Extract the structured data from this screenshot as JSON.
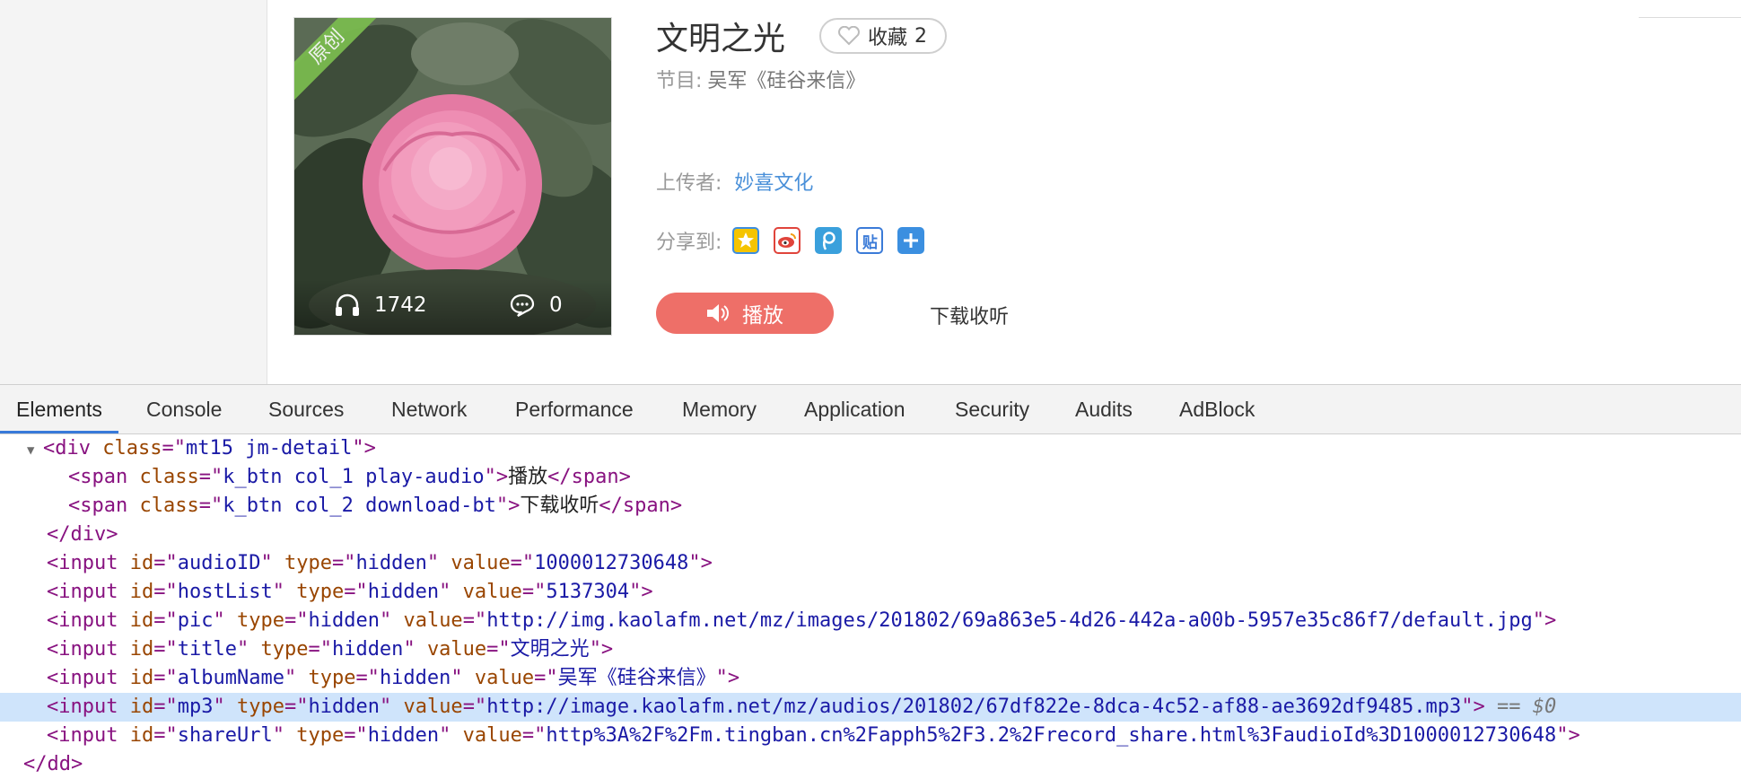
{
  "page": {
    "cover": {
      "badge": "原创",
      "listen_count": "1742",
      "comment_count": "0"
    },
    "title": "文明之光",
    "favorite": {
      "label": "收藏",
      "count": "2"
    },
    "program": {
      "label": "节目:",
      "value": "吴军《硅谷来信》"
    },
    "uploader": {
      "label": "上传者:",
      "value": "妙喜文化"
    },
    "share": {
      "label": "分享到:",
      "icons": [
        "qzone-icon",
        "weibo-icon",
        "tencent-weibo-icon",
        "tieba-icon",
        "more-share-icon"
      ],
      "tieba_glyph": "贴"
    },
    "play_label": "播放",
    "download_label": "下载收听",
    "accent": "#ee6f68",
    "link_color": "#4a90d9"
  },
  "devtools": {
    "tabs": [
      "Elements",
      "Console",
      "Sources",
      "Network",
      "Performance",
      "Memory",
      "Application",
      "Security",
      "Audits",
      "AdBlock"
    ],
    "active_tab": "Elements",
    "tree": {
      "div_open": {
        "tag": "div",
        "attr": "class",
        "value": "mt15 jm-detail"
      },
      "span1": {
        "tag": "span",
        "attr": "class",
        "value": "k_btn col_1 play-audio",
        "text": "播放"
      },
      "span2": {
        "tag": "span",
        "attr": "class",
        "value": "k_btn col_2 download-bt",
        "text": "下载收听"
      },
      "div_close": "</div>",
      "inputs": [
        {
          "id": "audioID",
          "type": "hidden",
          "value": "1000012730648"
        },
        {
          "id": "hostList",
          "type": "hidden",
          "value": "5137304"
        },
        {
          "id": "pic",
          "type": "hidden",
          "value": "http://img.kaolafm.net/mz/images/201802/69a863e5-4d26-442a-a00b-5957e35c86f7/default.jpg"
        },
        {
          "id": "title",
          "type": "hidden",
          "value": "文明之光"
        },
        {
          "id": "albumName",
          "type": "hidden",
          "value": "吴军《硅谷来信》"
        },
        {
          "id": "mp3",
          "type": "hidden",
          "value": "http://image.kaolafm.net/mz/audios/201802/67df822e-8dca-4c52-af88-ae3692df9485.mp3"
        },
        {
          "id": "shareUrl",
          "type": "hidden",
          "value": "http%3A%2F%2Fm.tingban.cn%2Fapph5%2F3.2%2Frecord_share.html%3FaudioId%3D1000012730648"
        }
      ],
      "selected_marker": "== $0",
      "dd_close": "</dd>"
    }
  }
}
